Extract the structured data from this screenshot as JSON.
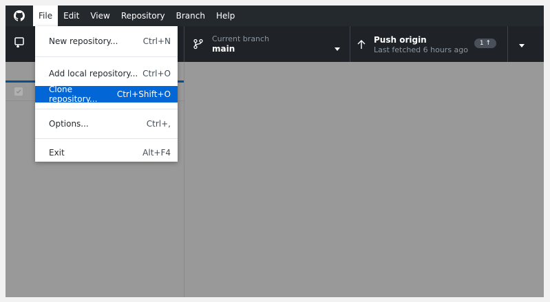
{
  "menubar": {
    "items": [
      "File",
      "Edit",
      "View",
      "Repository",
      "Branch",
      "Help"
    ]
  },
  "toolbar": {
    "branch_caption": "Current branch",
    "branch_value": "main",
    "push_title": "Push origin",
    "push_subtitle": "Last fetched 6 hours ago",
    "push_badge": "1 ↑"
  },
  "file_menu": {
    "items": [
      {
        "label": "New repository...",
        "shortcut": "Ctrl+N"
      },
      {
        "label": "Add local repository...",
        "shortcut": "Ctrl+O"
      },
      {
        "label": "Clone repository...",
        "shortcut": "Ctrl+Shift+O"
      },
      {
        "label": "Options...",
        "shortcut": "Ctrl+,"
      },
      {
        "label": "Exit",
        "shortcut": "Alt+F4"
      }
    ],
    "selected_index": 2
  },
  "colors": {
    "menubar_bg": "#24292e",
    "toolbar_bg": "#1f2328",
    "selection": "#0366d6",
    "overlay": "#999999"
  },
  "icons": {
    "app": "github-logo-icon",
    "repo": "repository-icon",
    "branch": "git-branch-icon",
    "push": "arrow-up-icon",
    "caret": "caret-down-icon"
  }
}
